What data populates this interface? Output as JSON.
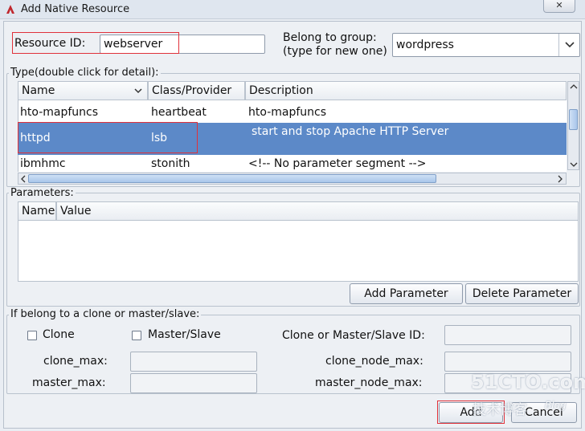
{
  "window": {
    "title": "Add Native Resource",
    "close_glyph": "✕"
  },
  "resource": {
    "label": "Resource ID:",
    "value": "webserver"
  },
  "group": {
    "label_line1": "Belong to group:",
    "label_line2": "(type for new one)",
    "value": "wordpress"
  },
  "type_section": {
    "legend": "Type(double click for detail):",
    "columns": [
      "Name",
      "Class/Provider",
      "Description"
    ],
    "rows": [
      {
        "name": "hto-mapfuncs",
        "provider": "heartbeat",
        "description": "hto-mapfuncs"
      },
      {
        "name": "httpd",
        "provider": "lsb",
        "description": "start and stop Apache HTTP Server"
      },
      {
        "name": "ibmhmc",
        "provider": "stonith",
        "description": "<!-- No parameter segment -->"
      }
    ]
  },
  "parameters": {
    "legend": "Parameters:",
    "columns": [
      "Name",
      "Value"
    ],
    "add_label": "Add Parameter",
    "delete_label": "Delete Parameter"
  },
  "clone_section": {
    "legend": "If belong to a clone or master/slave:",
    "clone_label": "Clone",
    "master_slave_label": "Master/Slave",
    "id_label": "Clone or Master/Slave ID:",
    "clone_max_label": "clone_max:",
    "clone_node_max_label": "clone_node_max:",
    "master_max_label": "master_max:",
    "master_node_max_label": "master_node_max:"
  },
  "footer": {
    "add_label": "Add",
    "cancel_label": "Cancel"
  },
  "watermark": {
    "logo": "51CTO.com",
    "sub": "技术博客",
    "blog": "Blog"
  },
  "colors": {
    "selection": "#5c89c8",
    "highlight_box": "#e0313a",
    "dialog_bg": "#edf0f4"
  }
}
